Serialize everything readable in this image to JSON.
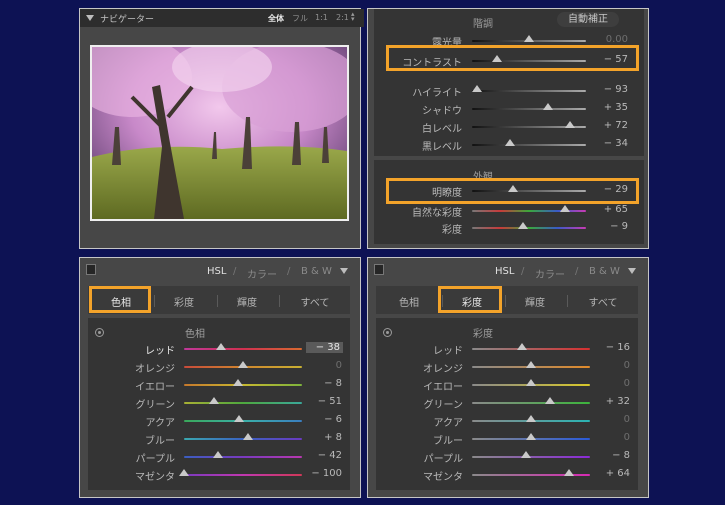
{
  "navigator": {
    "title": "ナビゲーター",
    "zoom": {
      "fit": "全体",
      "fill": "フル",
      "one": "1:1",
      "two": "2:1"
    }
  },
  "basic": {
    "tone_title": "階調",
    "auto_button": "自動補正",
    "sliders": [
      {
        "id": "exposure",
        "label": "露光量",
        "value": "0.00",
        "pos": 0.5
      },
      {
        "id": "contrast",
        "label": "コントラスト",
        "value": "− 57",
        "pos": 0.22
      },
      {
        "id": "highlights",
        "label": "ハイライト",
        "value": "− 93",
        "pos": 0.04
      },
      {
        "id": "shadows",
        "label": "シャドウ",
        "value": "+ 35",
        "pos": 0.67
      },
      {
        "id": "whites",
        "label": "白レベル",
        "value": "+ 72",
        "pos": 0.86
      },
      {
        "id": "blacks",
        "label": "黒レベル",
        "value": "− 34",
        "pos": 0.33
      }
    ],
    "presence_title": "外観",
    "presence": [
      {
        "id": "clarity",
        "label": "明瞭度",
        "value": "− 29",
        "pos": 0.36
      },
      {
        "id": "vibrance",
        "label": "自然な彩度",
        "value": "+ 65",
        "pos": 0.82
      },
      {
        "id": "saturation",
        "label": "彩度",
        "value": "− 9",
        "pos": 0.45
      }
    ]
  },
  "hsl_header": {
    "hsl": "HSL",
    "slash": "/",
    "color": "カラー",
    "bw": "B & W"
  },
  "tabs": {
    "hue": "色相",
    "saturation": "彩度",
    "luminance": "輝度",
    "all": "すべて"
  },
  "hue_panel": {
    "title": "色相",
    "sliders": [
      {
        "id": "red",
        "label": "レッド",
        "value": "− 38",
        "pos": 0.31
      },
      {
        "id": "orange",
        "label": "オレンジ",
        "value": "0",
        "pos": 0.5
      },
      {
        "id": "yellow",
        "label": "イエロー",
        "value": "− 8",
        "pos": 0.46
      },
      {
        "id": "green",
        "label": "グリーン",
        "value": "− 51",
        "pos": 0.25
      },
      {
        "id": "aqua",
        "label": "アクア",
        "value": "− 6",
        "pos": 0.47
      },
      {
        "id": "blue",
        "label": "ブルー",
        "value": "+ 8",
        "pos": 0.54
      },
      {
        "id": "purple",
        "label": "パープル",
        "value": "− 42",
        "pos": 0.29
      },
      {
        "id": "magenta",
        "label": "マゼンタ",
        "value": "− 100",
        "pos": 0.0
      }
    ]
  },
  "sat_panel": {
    "title": "彩度",
    "sliders": [
      {
        "id": "red",
        "label": "レッド",
        "value": "− 16",
        "pos": 0.42
      },
      {
        "id": "orange",
        "label": "オレンジ",
        "value": "0",
        "pos": 0.5
      },
      {
        "id": "yellow",
        "label": "イエロー",
        "value": "0",
        "pos": 0.5
      },
      {
        "id": "green",
        "label": "グリーン",
        "value": "+ 32",
        "pos": 0.66
      },
      {
        "id": "aqua",
        "label": "アクア",
        "value": "0",
        "pos": 0.5
      },
      {
        "id": "blue",
        "label": "ブルー",
        "value": "0",
        "pos": 0.5
      },
      {
        "id": "purple",
        "label": "パープル",
        "value": "− 8",
        "pos": 0.46
      },
      {
        "id": "magenta",
        "label": "マゼンタ",
        "value": "+ 64",
        "pos": 0.82
      }
    ]
  },
  "colors": {
    "background": "#0d1254",
    "highlight": "#f3a32a"
  }
}
